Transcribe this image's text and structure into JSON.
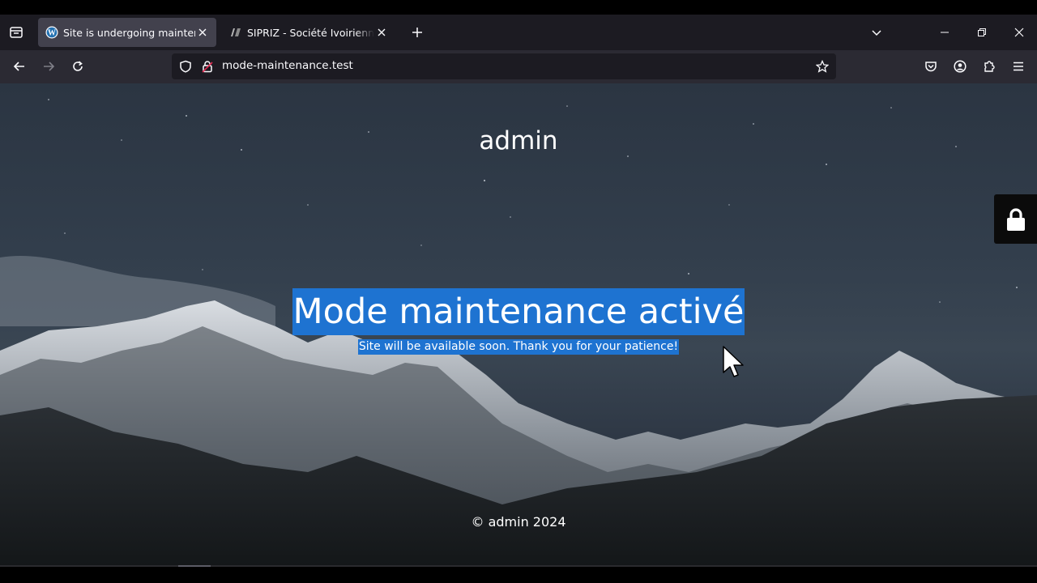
{
  "browser": {
    "tabs": [
      {
        "title": "Site is undergoing maintenance",
        "favicon": "wordpress-icon",
        "active": true
      },
      {
        "title": "SIPRIZ - Société Ivoirienne de P",
        "favicon": "sipriz-logo-icon",
        "active": false
      }
    ],
    "url": "mode-maintenance.test"
  },
  "page": {
    "site_title": "admin",
    "headline": "Mode maintenance activé",
    "subtitle": "Site will be available soon. Thank you for your patience!",
    "footer": "© admin 2024"
  },
  "colors": {
    "selection": "#1e73d1",
    "tabstrip": "#1c1b22",
    "toolbar": "#2b2a33",
    "active_tab": "#42414d"
  }
}
